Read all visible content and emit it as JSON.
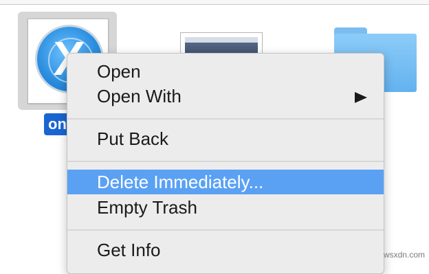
{
  "files": {
    "selected_label": "on",
    "app_icon_glyph": "X",
    "icons": [
      "app-icon",
      "screenshot-thumbnail",
      "folder-icon"
    ]
  },
  "menu": {
    "open": "Open",
    "open_with": "Open With",
    "put_back": "Put Back",
    "delete_immediately": "Delete Immediately...",
    "empty_trash": "Empty Trash",
    "get_info": "Get Info"
  },
  "colors": {
    "highlight": "#5aa1f4",
    "selection_label": "#1a65d2",
    "folder": "#63b2ef"
  },
  "watermark": "wsxdn.com"
}
